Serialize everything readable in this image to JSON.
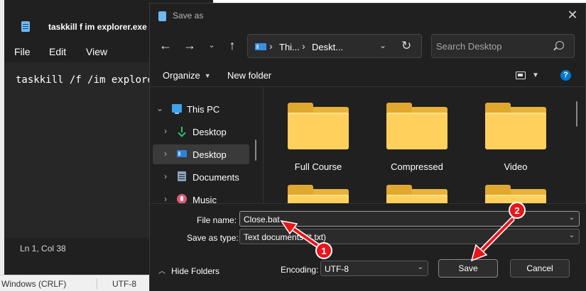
{
  "notepad": {
    "title": "taskkill f im explorer.exe T",
    "menu": [
      "File",
      "Edit",
      "View"
    ],
    "content": "taskkill /f /im explorer",
    "status_position": "Ln 1, Col 38",
    "status_eol": "Windows (CRLF)",
    "status_encoding": "UTF-8"
  },
  "dialog": {
    "title": "Save as",
    "address": {
      "crumbs": [
        "Thi...",
        "Deskt..."
      ]
    },
    "search_placeholder": "Search Desktop",
    "commands": {
      "organize": "Organize",
      "new_folder": "New folder"
    },
    "nav": [
      {
        "label": "This PC",
        "icon": "computer-icon"
      },
      {
        "label": "Desktop",
        "icon": "download-arrow-icon"
      },
      {
        "label": "Desktop",
        "icon": "desktop-icon",
        "selected": true
      },
      {
        "label": "Documents",
        "icon": "documents-icon"
      },
      {
        "label": "Music",
        "icon": "music-icon"
      }
    ],
    "files": [
      {
        "label": "Full Course",
        "icon": "folder-icon"
      },
      {
        "label": "Compressed",
        "icon": "folder-icon"
      },
      {
        "label": "Video",
        "icon": "folder-icon"
      },
      {
        "label": "",
        "icon": "folder-icon"
      },
      {
        "label": "",
        "icon": "folder-icon"
      },
      {
        "label": "",
        "icon": "folder-icon"
      }
    ],
    "form": {
      "file_name_label": "File name:",
      "file_name_value": "Close.bat",
      "save_type_label": "Save as type:",
      "save_type_value": "Text documents (*.txt)",
      "encoding_label": "Encoding:",
      "encoding_value": "UTF-8",
      "hide_folders": "Hide Folders",
      "save_button": "Save",
      "cancel_button": "Cancel"
    }
  },
  "annotations": {
    "color": "#e8151b",
    "markers": [
      "1",
      "2"
    ]
  }
}
